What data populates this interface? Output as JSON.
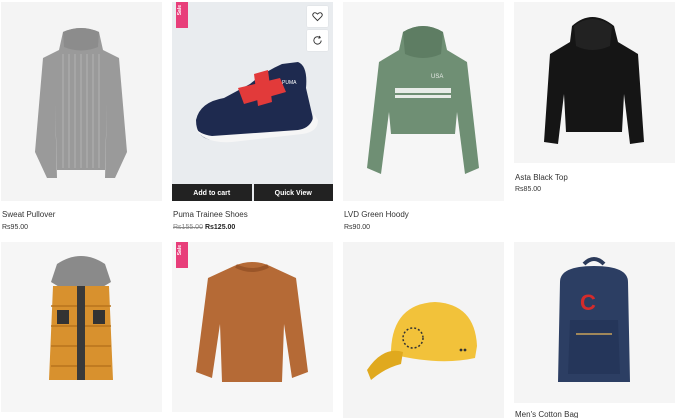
{
  "products": [
    {
      "name": "Sweat Pullover",
      "price": "Rs95.00"
    },
    {
      "name": "Puma Trainee Shoes",
      "old_price": "Rs155.00",
      "price": "Rs125.00",
      "badge": "Sale",
      "actions": {
        "add_to_cart": "Add to cart",
        "quick_view": "Quick View"
      }
    },
    {
      "name": "LVD Green Hoody",
      "price": "Rs90.00"
    },
    {
      "name": "Asta Black Top",
      "price": "Rs85.00"
    },
    {
      "name": "",
      "price": ""
    },
    {
      "name": "",
      "price": "",
      "badge": "Sale"
    },
    {
      "name": "",
      "price": ""
    },
    {
      "name": "Men's Cotton Bag",
      "price": ""
    }
  ],
  "icons": {
    "wishlist": "heart-icon",
    "compare": "refresh-icon"
  },
  "colors": {
    "sale_badge": "#e83e7a",
    "action_bar": "#222222"
  }
}
